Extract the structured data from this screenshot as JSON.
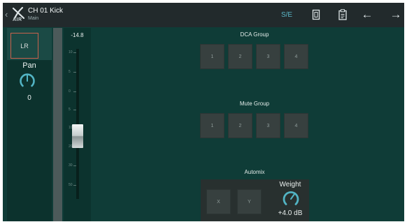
{
  "header": {
    "logo_text": "AIR",
    "channel_title": "CH 01 Kick",
    "subtitle": "Main",
    "se_label": "S/E",
    "copy_icon": "copy-icon",
    "paste_icon": "paste-icon",
    "back_arrow": "←",
    "forward_arrow": "→"
  },
  "left_panel": {
    "bus_label": "LR",
    "pan_label": "Pan",
    "pan_value": "0",
    "pan_level": 0.5
  },
  "fader": {
    "level": "-14.8",
    "scale": [
      "10",
      "5",
      "0",
      "5",
      "10",
      "20",
      "30",
      "50"
    ],
    "position": 0.6
  },
  "dca_group": {
    "title": "DCA Group",
    "buttons": [
      "1",
      "2",
      "3",
      "4"
    ]
  },
  "mute_group": {
    "title": "Mute Group",
    "buttons": [
      "1",
      "2",
      "3",
      "4"
    ]
  },
  "automix": {
    "title": "Automix",
    "buttons": [
      "X",
      "Y"
    ],
    "weight_label": "Weight",
    "weight_value": "+4.0 dB"
  },
  "colors": {
    "background": "#0f3c37",
    "accent": "#5ab6c6",
    "knob_arc": "#52b4c4",
    "bus_border": "#c8624d"
  }
}
